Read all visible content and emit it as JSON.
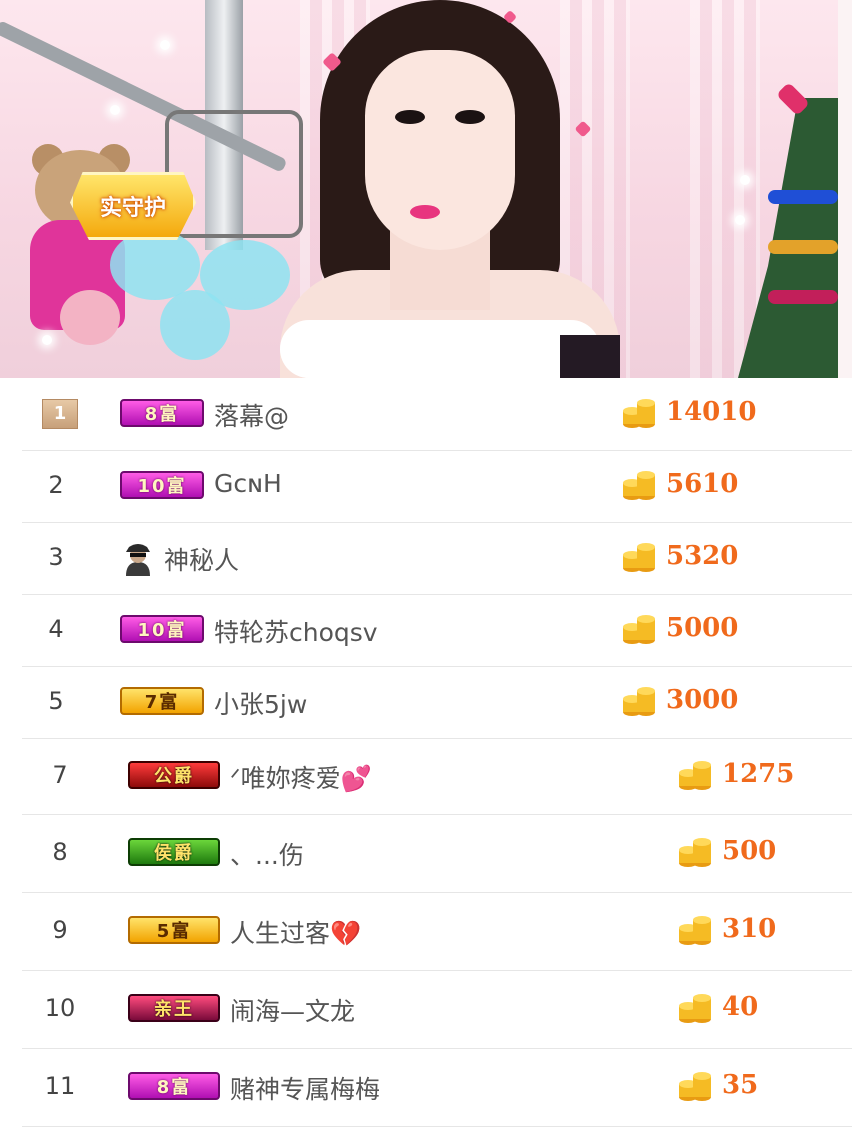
{
  "stream": {
    "guard_badge": "实守护"
  },
  "ranking": [
    {
      "rank": "1",
      "level_badge": "8富",
      "level_style": "magenta",
      "name": "落幕@",
      "coins": "14010"
    },
    {
      "rank": "2",
      "level_badge": "10富",
      "level_style": "magenta",
      "name": "GᴄɴH",
      "coins": "5610"
    },
    {
      "rank": "3",
      "level_badge": "",
      "level_style": "mystery",
      "name": "神秘人",
      "coins": "5320"
    },
    {
      "rank": "4",
      "level_badge": "10富",
      "level_style": "magenta",
      "name": "特轮苏choqsv",
      "coins": "5000"
    },
    {
      "rank": "5",
      "level_badge": "7富",
      "level_style": "gold",
      "name": "小张5jw",
      "coins": "3000"
    },
    {
      "rank": "7",
      "level_badge": "公爵",
      "level_style": "duke",
      "name": "ᐟ唯妳疼爱💕",
      "coins": "1275"
    },
    {
      "rank": "8",
      "level_badge": "侯爵",
      "level_style": "marquis",
      "name": "、...伤",
      "coins": "500"
    },
    {
      "rank": "9",
      "level_badge": "5富",
      "level_style": "gold",
      "name": "人生过客💔",
      "coins": "310"
    },
    {
      "rank": "10",
      "level_badge": "亲王",
      "level_style": "prince",
      "name": "闹海—文龙",
      "coins": "40"
    },
    {
      "rank": "11",
      "level_badge": "8富",
      "level_style": "magenta",
      "name": "赌神专属梅梅",
      "coins": "35"
    }
  ],
  "icons": {
    "coin": "gold-coin-stack-icon",
    "mystery": "mystery-user-icon"
  },
  "colors": {
    "amount": "#f06a1c",
    "divider": "#e6e6e6",
    "rank_text": "#444444"
  }
}
